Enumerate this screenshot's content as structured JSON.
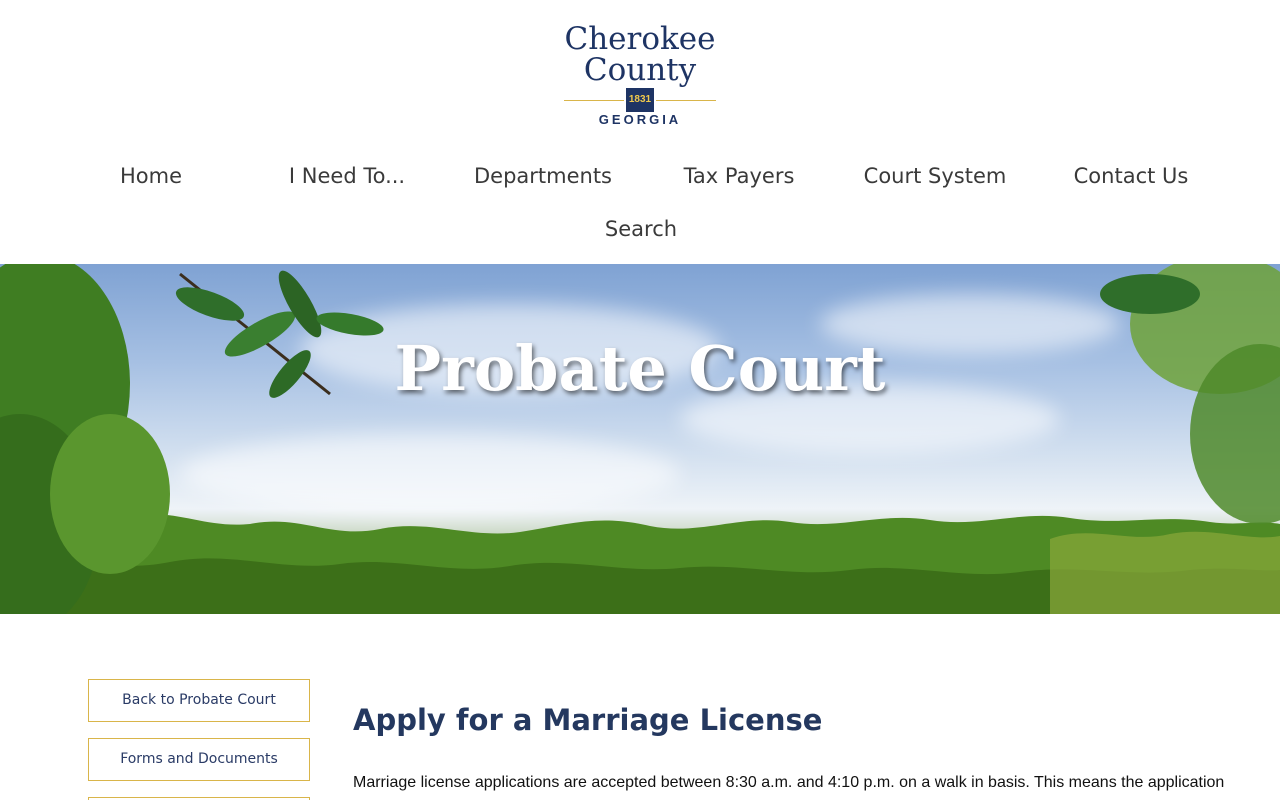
{
  "logo": {
    "line1": "Cherokee",
    "line2": "County",
    "year": "1831",
    "state": "GEORGIA"
  },
  "nav": {
    "row1": [
      "Home",
      "I  Need To...",
      "Departments",
      "Tax  Payers",
      "Court System",
      "Contact Us"
    ],
    "search": "Search"
  },
  "hero": {
    "title": "Probate Court"
  },
  "sidebar": {
    "items": [
      "Back to  Probate Court",
      "Forms and  Documents"
    ]
  },
  "main": {
    "title": "Apply for a  Marriage  License",
    "body": "Marriage license applications are accepted between 8:30 a.m. and 4:10 p.m. on a walk in basis. This means the application"
  },
  "colors": {
    "brand_navy": "#1e3464",
    "accent_gold": "#d9b54a"
  }
}
